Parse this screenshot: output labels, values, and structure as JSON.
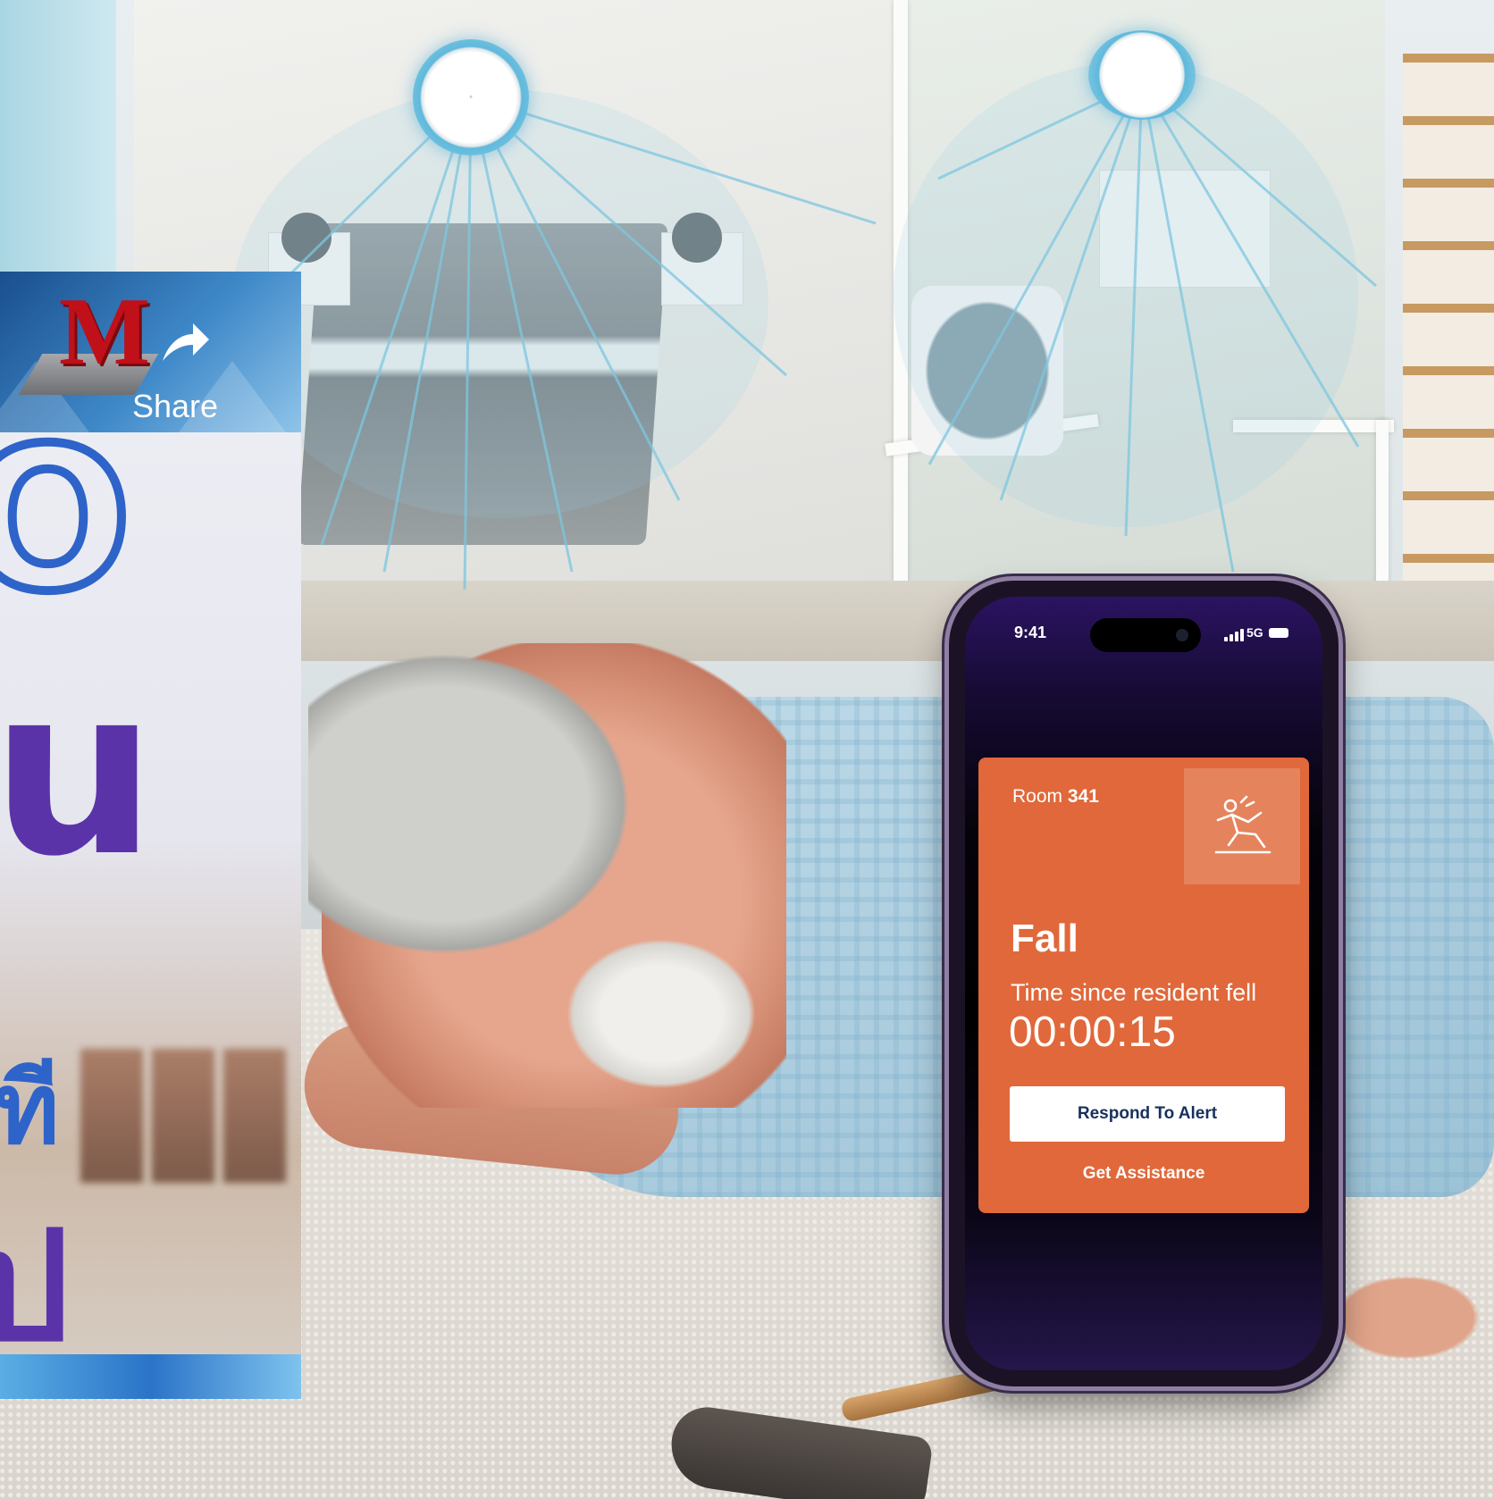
{
  "thumbnail": {
    "logo_letter": "M",
    "logo_text": "Share",
    "glyphs": [
      "O",
      "u",
      "ที",
      "ป"
    ]
  },
  "phone": {
    "status": {
      "time": "9:41",
      "network": "5G"
    },
    "alert": {
      "room_label": "Room",
      "room_number": "341",
      "icon": "person-falling-icon",
      "title": "Fall",
      "subtitle": "Time since resident fell",
      "timer": "00:00:15",
      "primary_action": "Respond To Alert",
      "secondary_action": "Get Assistance"
    },
    "colors": {
      "alert_card": "#e0683a",
      "primary_button_text": "#17305e",
      "screen_top": "#2b1362"
    }
  },
  "scene": {
    "sensor_beam_color": "#7cc6df"
  }
}
